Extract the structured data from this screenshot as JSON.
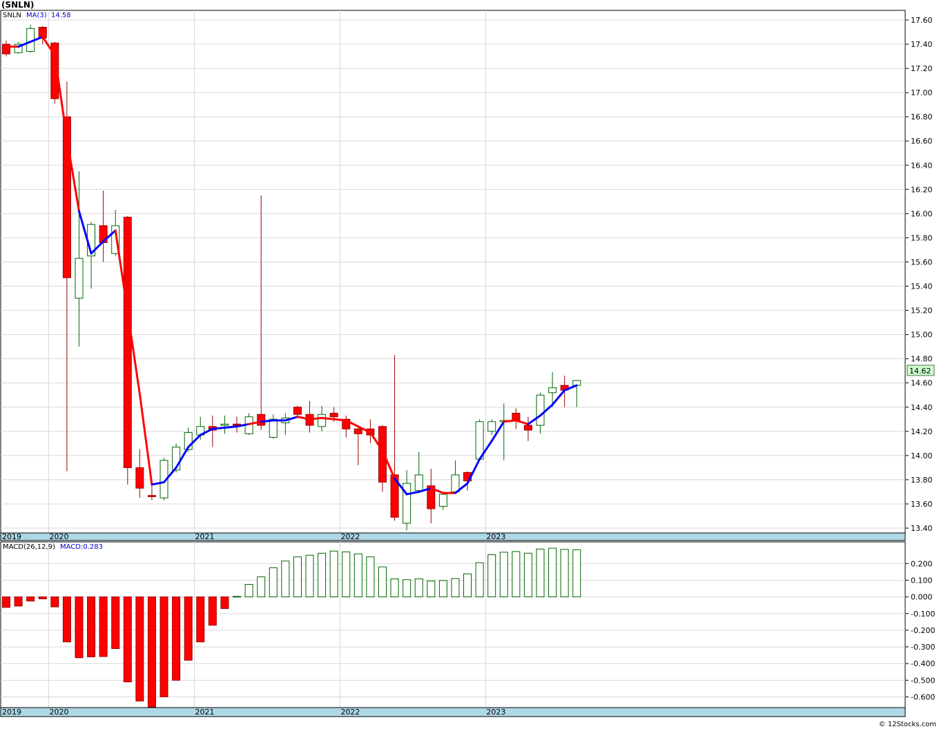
{
  "chart_data": [
    {
      "type": "candlestick",
      "title": "(SNLN)",
      "legend": {
        "symbol": "SNLN",
        "ma_label": "MA(3)",
        "ma_value": "14.58"
      },
      "ylim": [
        13.4,
        17.6
      ],
      "yticks": [
        "17.60",
        "17.40",
        "17.20",
        "17.00",
        "16.80",
        "16.60",
        "16.40",
        "16.20",
        "16.00",
        "15.80",
        "15.60",
        "15.40",
        "15.20",
        "15.00",
        "14.80",
        "14.60",
        "14.40",
        "14.20",
        "14.00",
        "13.80",
        "13.60",
        "13.40"
      ],
      "last_price": "14.62",
      "year_labels": [
        {
          "text": "2019",
          "x": 0.0
        },
        {
          "text": "2020",
          "x": 3.5
        },
        {
          "text": "2021",
          "x": 15.5
        },
        {
          "text": "2022",
          "x": 27.5
        },
        {
          "text": "2023",
          "x": 39.5
        }
      ],
      "candles": [
        {
          "o": 17.4,
          "h": 17.43,
          "l": 17.3,
          "c": 17.32
        },
        {
          "o": 17.33,
          "h": 17.42,
          "l": 17.32,
          "c": 17.4
        },
        {
          "o": 17.34,
          "h": 17.56,
          "l": 17.33,
          "c": 17.53
        },
        {
          "o": 17.54,
          "h": 17.55,
          "l": 17.4,
          "c": 17.45
        },
        {
          "o": 17.41,
          "h": 17.42,
          "l": 16.91,
          "c": 16.95
        },
        {
          "o": 16.8,
          "h": 17.09,
          "l": 13.87,
          "c": 15.47
        },
        {
          "o": 15.3,
          "h": 16.35,
          "l": 14.9,
          "c": 15.63
        },
        {
          "o": 15.65,
          "h": 15.93,
          "l": 15.38,
          "c": 15.91
        },
        {
          "o": 15.9,
          "h": 16.19,
          "l": 15.6,
          "c": 15.76
        },
        {
          "o": 15.67,
          "h": 16.03,
          "l": 15.65,
          "c": 15.9
        },
        {
          "o": 15.97,
          "h": 15.98,
          "l": 13.76,
          "c": 13.9
        },
        {
          "o": 13.9,
          "h": 14.05,
          "l": 13.65,
          "c": 13.73
        },
        {
          "o": 13.67,
          "h": 13.75,
          "l": 13.63,
          "c": 13.66
        },
        {
          "o": 13.65,
          "h": 13.98,
          "l": 13.63,
          "c": 13.96
        },
        {
          "o": 13.88,
          "h": 14.1,
          "l": 13.86,
          "c": 14.07
        },
        {
          "o": 14.05,
          "h": 14.23,
          "l": 14.03,
          "c": 14.19
        },
        {
          "o": 14.17,
          "h": 14.32,
          "l": 14.13,
          "c": 14.24
        },
        {
          "o": 14.24,
          "h": 14.33,
          "l": 14.07,
          "c": 14.21
        },
        {
          "o": 14.25,
          "h": 14.33,
          "l": 14.18,
          "c": 14.26
        },
        {
          "o": 14.26,
          "h": 14.32,
          "l": 14.19,
          "c": 14.25
        },
        {
          "o": 14.18,
          "h": 14.35,
          "l": 14.17,
          "c": 14.32
        },
        {
          "o": 14.34,
          "h": 16.15,
          "l": 14.21,
          "c": 14.25
        },
        {
          "o": 14.15,
          "h": 14.34,
          "l": 14.14,
          "c": 14.3
        },
        {
          "o": 14.27,
          "h": 14.35,
          "l": 14.17,
          "c": 14.31
        },
        {
          "o": 14.4,
          "h": 14.41,
          "l": 14.32,
          "c": 14.34
        },
        {
          "o": 14.34,
          "h": 14.45,
          "l": 14.19,
          "c": 14.25
        },
        {
          "o": 14.24,
          "h": 14.41,
          "l": 14.2,
          "c": 14.34
        },
        {
          "o": 14.35,
          "h": 14.4,
          "l": 14.28,
          "c": 14.32
        },
        {
          "o": 14.3,
          "h": 14.33,
          "l": 14.15,
          "c": 14.22
        },
        {
          "o": 14.22,
          "h": 14.25,
          "l": 13.92,
          "c": 14.18
        },
        {
          "o": 14.22,
          "h": 14.3,
          "l": 14.1,
          "c": 14.17
        },
        {
          "o": 14.24,
          "h": 14.25,
          "l": 13.7,
          "c": 13.78
        },
        {
          "o": 13.84,
          "h": 14.83,
          "l": 13.46,
          "c": 13.49
        },
        {
          "o": 13.44,
          "h": 13.88,
          "l": 13.38,
          "c": 13.77
        },
        {
          "o": 13.71,
          "h": 14.03,
          "l": 13.7,
          "c": 13.84
        },
        {
          "o": 13.75,
          "h": 13.89,
          "l": 13.44,
          "c": 13.56
        },
        {
          "o": 13.58,
          "h": 13.68,
          "l": 13.55,
          "c": 13.68
        },
        {
          "o": 13.7,
          "h": 13.96,
          "l": 13.69,
          "c": 13.84
        },
        {
          "o": 13.86,
          "h": 13.87,
          "l": 13.71,
          "c": 13.79
        },
        {
          "o": 13.97,
          "h": 14.3,
          "l": 13.96,
          "c": 14.28
        },
        {
          "o": 14.2,
          "h": 14.3,
          "l": 14.17,
          "c": 14.28
        },
        {
          "o": 14.28,
          "h": 14.43,
          "l": 13.96,
          "c": 14.29
        },
        {
          "o": 14.35,
          "h": 14.39,
          "l": 14.22,
          "c": 14.29
        },
        {
          "o": 14.25,
          "h": 14.32,
          "l": 14.12,
          "c": 14.21
        },
        {
          "o": 14.25,
          "h": 14.52,
          "l": 14.18,
          "c": 14.5
        },
        {
          "o": 14.52,
          "h": 14.69,
          "l": 14.4,
          "c": 14.56
        },
        {
          "o": 14.58,
          "h": 14.66,
          "l": 14.4,
          "c": 14.54
        },
        {
          "o": 14.58,
          "h": 14.62,
          "l": 14.4,
          "c": 14.62
        }
      ],
      "ma": [
        17.38,
        17.38,
        17.42,
        17.46,
        17.31,
        16.62,
        16.02,
        15.67,
        15.77,
        15.86,
        15.19,
        14.51,
        13.76,
        13.78,
        13.9,
        14.07,
        14.17,
        14.22,
        14.23,
        14.24,
        14.26,
        14.28,
        14.29,
        14.29,
        14.32,
        14.3,
        14.31,
        14.3,
        14.29,
        14.24,
        14.19,
        14.04,
        13.81,
        13.68,
        13.7,
        13.73,
        13.69,
        13.69,
        13.77,
        13.97,
        14.12,
        14.28,
        14.29,
        14.26,
        14.33,
        14.42,
        14.54,
        14.58
      ],
      "ma_colors": [
        "#ff0000",
        "#ff0000",
        "#0000ff",
        "#0000ff",
        "#ff0000",
        "#ff0000",
        "#ff0000",
        "#0000ff",
        "#0000ff",
        "#0000ff",
        "#ff0000",
        "#ff0000",
        "#ff0000",
        "#0000ff",
        "#0000ff",
        "#0000ff",
        "#0000ff",
        "#0000ff",
        "#0000ff",
        "#0000ff",
        "#0000ff",
        "#ff0000",
        "#0000ff",
        "#0000ff",
        "#0000ff",
        "#ff0000",
        "#ff0000",
        "#ff0000",
        "#ff0000",
        "#ff0000",
        "#ff0000",
        "#ff0000",
        "#ff0000",
        "#0000ff",
        "#0000ff",
        "#0000ff",
        "#ff0000",
        "#ff0000",
        "#0000ff",
        "#0000ff",
        "#0000ff",
        "#0000ff",
        "#ff0000",
        "#ff0000",
        "#0000ff",
        "#0000ff",
        "#0000ff",
        "#0000ff"
      ],
      "colors": {
        "up_fill": "#ffffff",
        "up_stroke": "#006600",
        "down_fill": "#ff0000",
        "down_stroke": "#990000",
        "axis_band": "#add8e6",
        "grid": "#d8d8d8",
        "last_price_bg": "#ccffcc"
      }
    },
    {
      "type": "bar",
      "legend": {
        "label": "MACD(26,12,9)",
        "value_label": "MACD:0.283"
      },
      "ylim": [
        -0.66,
        0.28
      ],
      "yticks": [
        "0.200",
        "0.100",
        "0.000",
        "-0.100",
        "-0.200",
        "-0.300",
        "-0.400",
        "-0.500",
        "-0.600"
      ],
      "year_labels": [
        {
          "text": "2019",
          "x": 0.0
        },
        {
          "text": "2020",
          "x": 3.5
        },
        {
          "text": "2021",
          "x": 15.5
        },
        {
          "text": "2022",
          "x": 27.5
        },
        {
          "text": "2023",
          "x": 39.5
        }
      ],
      "values": [
        -0.063,
        -0.055,
        -0.025,
        -0.012,
        -0.06,
        -0.27,
        -0.365,
        -0.36,
        -0.358,
        -0.31,
        -0.51,
        -0.625,
        -0.66,
        -0.6,
        -0.5,
        -0.38,
        -0.27,
        -0.17,
        -0.07,
        0.003,
        0.075,
        0.12,
        0.175,
        0.215,
        0.24,
        0.25,
        0.262,
        0.275,
        0.27,
        0.258,
        0.24,
        0.18,
        0.108,
        0.103,
        0.108,
        0.095,
        0.098,
        0.11,
        0.138,
        0.205,
        0.253,
        0.268,
        0.272,
        0.262,
        0.287,
        0.292,
        0.285,
        0.283
      ],
      "colors": {
        "positive_stroke": "#006600",
        "negative_fill": "#ff0000",
        "negative_stroke": "#990000"
      }
    }
  ],
  "footer": {
    "credit": "© 12Stocks.com"
  }
}
